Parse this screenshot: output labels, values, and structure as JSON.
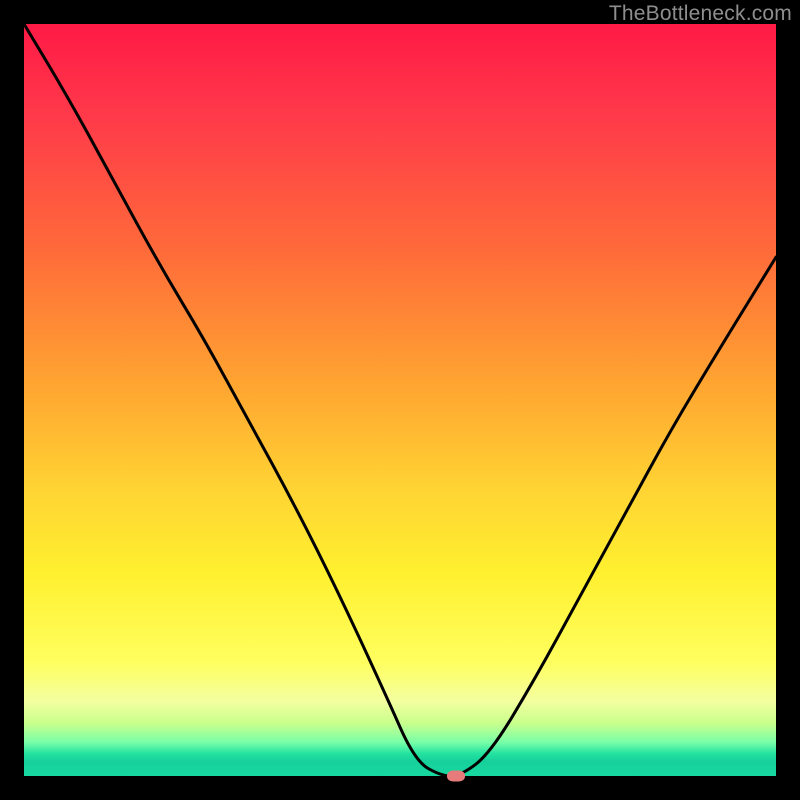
{
  "watermark": "TheBottleneck.com",
  "colors": {
    "frame": "#000000",
    "curve": "#000000",
    "marker": "#e77a7a"
  },
  "chart_data": {
    "type": "line",
    "title": "",
    "xlabel": "",
    "ylabel": "",
    "xlim": [
      0,
      1
    ],
    "ylim": [
      0,
      1
    ],
    "series": [
      {
        "name": "bottleneck-curve",
        "x": [
          0.0,
          0.06,
          0.12,
          0.18,
          0.24,
          0.3,
          0.36,
          0.42,
          0.48,
          0.52,
          0.555,
          0.58,
          0.62,
          0.68,
          0.74,
          0.8,
          0.86,
          0.92,
          1.0
        ],
        "y": [
          1.0,
          0.9,
          0.79,
          0.68,
          0.58,
          0.47,
          0.36,
          0.24,
          0.11,
          0.02,
          0.0,
          0.0,
          0.03,
          0.13,
          0.24,
          0.35,
          0.46,
          0.56,
          0.69
        ]
      }
    ],
    "annotations": [
      {
        "name": "valley-marker",
        "x": 0.575,
        "y": 0.0
      }
    ],
    "background_gradient": {
      "top": "#ff1a46",
      "mid": "#ffd433",
      "bottom": "#17d79f"
    }
  }
}
